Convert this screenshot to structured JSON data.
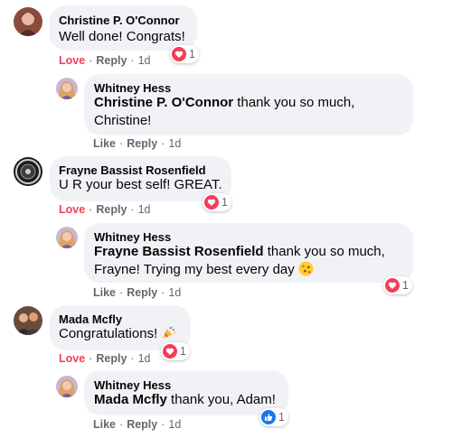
{
  "comments": [
    {
      "author": "Christine P. O'Connor",
      "text": "Well done! Congrats!",
      "actions": {
        "love": "Love",
        "reply": "Reply",
        "time": "1d"
      },
      "reaction_count": "1"
    },
    {
      "author": "Whitney Hess",
      "mention": "Christine P. O'Connor",
      "text": " thank you so much, Christine!",
      "actions": {
        "like": "Like",
        "reply": "Reply",
        "time": "1d"
      }
    },
    {
      "author": "Frayne Bassist Rosenfield",
      "text": "U R your best self! GREAT.",
      "actions": {
        "love": "Love",
        "reply": "Reply",
        "time": "1d"
      },
      "reaction_count": "1"
    },
    {
      "author": "Whitney Hess",
      "mention": "Frayne Bassist Rosenfield",
      "text": " thank you so much, Frayne! Trying my best every day ",
      "actions": {
        "like": "Like",
        "reply": "Reply",
        "time": "1d"
      },
      "reaction_count": "1"
    },
    {
      "author": "Mada Mcfly",
      "text": "Congratulations! ",
      "actions": {
        "love": "Love",
        "reply": "Reply",
        "time": "1d"
      },
      "reaction_count": "1"
    },
    {
      "author": "Whitney Hess",
      "mention": "Mada Mcfly",
      "text": " thank you, Adam!",
      "actions": {
        "like": "Like",
        "reply": "Reply",
        "time": "1d"
      },
      "reaction_count": "1"
    }
  ],
  "colors": {
    "love": "#f33e58",
    "like": "#1877f2",
    "bubble": "#f0f2f5",
    "meta": "#65676b"
  },
  "icons": [
    "heart-reaction-icon",
    "like-reaction-icon",
    "blowing-kiss-emoji-icon",
    "party-popper-emoji-icon"
  ]
}
